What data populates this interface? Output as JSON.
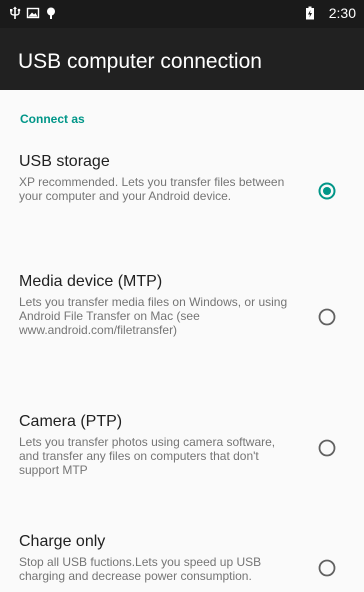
{
  "status_bar": {
    "time": "2:30",
    "icons": [
      "usb-icon",
      "image-icon",
      "notification-icon",
      "battery-icon"
    ]
  },
  "toolbar": {
    "title": "USB computer connection"
  },
  "section": {
    "label": "Connect as"
  },
  "options": [
    {
      "title": "USB storage",
      "description": "XP recommended. Lets you transfer files between your computer and your Android device.",
      "selected": true
    },
    {
      "title": "Media device (MTP)",
      "description": "Lets you transfer media files on Windows, or using Android File Transfer on Mac (see www.android.com/filetransfer)",
      "selected": false
    },
    {
      "title": "Camera (PTP)",
      "description": "Lets you transfer photos using camera software, and transfer any files on computers that don't support MTP",
      "selected": false
    },
    {
      "title": "Charge only",
      "description": "Stop all USB fuctions.Lets you speed up USB charging and decrease power consumption.",
      "selected": false
    }
  ],
  "colors": {
    "accent": "#009688",
    "toolbar": "#212121",
    "statusbar": "#1a1a1a"
  }
}
